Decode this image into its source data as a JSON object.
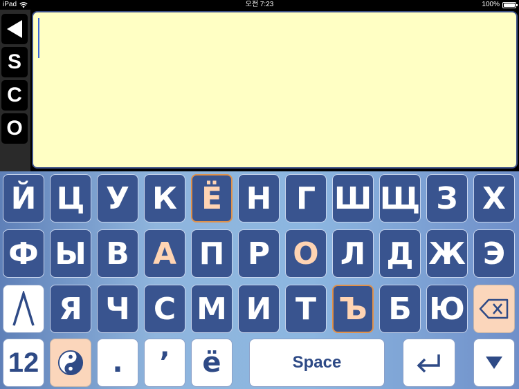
{
  "status_bar": {
    "device": "iPad",
    "time": "오전 7:23",
    "battery": "100%",
    "battery_level": 1.0
  },
  "side_buttons": [
    "S",
    "C",
    "O"
  ],
  "keyboard": {
    "row1": [
      "Й",
      "Ц",
      "У",
      "К",
      "Ё",
      "Н",
      "Г",
      "Ш",
      "Щ",
      "З",
      "Х"
    ],
    "row2": [
      "Ф",
      "Ы",
      "В",
      "А",
      "П",
      "Р",
      "О",
      "Л",
      "Д",
      "Ж",
      "Э"
    ],
    "row3": [
      "Я",
      "Ч",
      "С",
      "М",
      "И",
      "Т",
      "Ъ",
      "Б",
      "Ю"
    ],
    "numbers_label": "12",
    "period_label": ".",
    "apostrophe_label": "ʼ",
    "yo_label": "ё",
    "space_label": "Space",
    "shift_icon": "shift-chevron-icon",
    "backspace_icon": "backspace-icon",
    "yin_yang_icon": "yin-yang-icon",
    "return_icon": "return-icon",
    "hide_icon": "hide-keyboard-icon"
  },
  "colors": {
    "key_blue": "#39548f",
    "key_highlight_text": "#ffd4b3",
    "key_orange_border": "#e0914a",
    "text_area_bg": "#ffffc4",
    "peach_key": "#fbd6bb"
  }
}
